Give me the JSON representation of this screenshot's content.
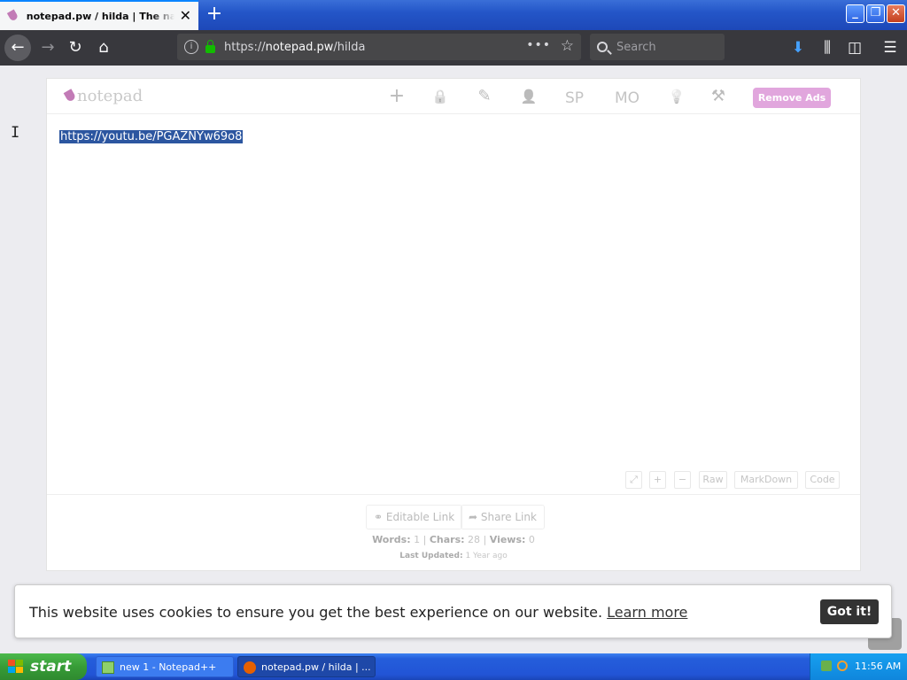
{
  "browser": {
    "tab_title": "notepad.pw / hilda | The napkin of the internet",
    "close_glyph": "✕",
    "new_tab_glyph": "+",
    "url_prefix": "https://",
    "url_domain": "notepad.pw",
    "url_path": "/hilda",
    "page_actions_glyph": "•••",
    "bookmark_glyph": "☆",
    "search_placeholder": "Search",
    "window_buttons": {
      "minimize": "_",
      "maximize": "❐",
      "close": "✕"
    },
    "nav": {
      "back": "←",
      "forward": "→",
      "reload": "↻",
      "home": "⌂"
    },
    "toolbar": {
      "downloads": "⬇",
      "library": "⫼",
      "sidebar": "◫",
      "menu": "☰"
    }
  },
  "notepad": {
    "logo_text": "notepad",
    "header_icons": {
      "new": "+",
      "lock": "🔒",
      "edit": "✎",
      "user": "👤",
      "spellcheck": "SP",
      "monospace": "MO",
      "idea": "💡",
      "tools": "⚒"
    },
    "remove_ads_label": "Remove Ads",
    "content_text": "https://youtu.be/PGAZNYw69o8",
    "tool_buttons": {
      "expand": "⤢",
      "zoom_in": "+",
      "zoom_out": "−",
      "raw": "Raw",
      "markdown": "MarkDown",
      "code": "Code"
    },
    "editable_link_label": "Editable Link",
    "share_link_label": "Share Link",
    "stats": {
      "words_label": "Words:",
      "words": "1",
      "chars_label": "Chars:",
      "chars": "28",
      "views_label": "Views:",
      "views": "0",
      "sep": "|"
    },
    "updated": {
      "label": "Last Updated:",
      "value": "1 Year ago"
    }
  },
  "cookie": {
    "message": "This website uses cookies to ensure you get the best experience on our website.",
    "learn_more": "Learn more",
    "got_it": "Got it!"
  },
  "taskbar": {
    "start_label": "start",
    "tasks": [
      {
        "label": "new 1 - Notepad++"
      },
      {
        "label": "notepad.pw / hilda | ..."
      }
    ],
    "clock": "11:56 AM"
  }
}
